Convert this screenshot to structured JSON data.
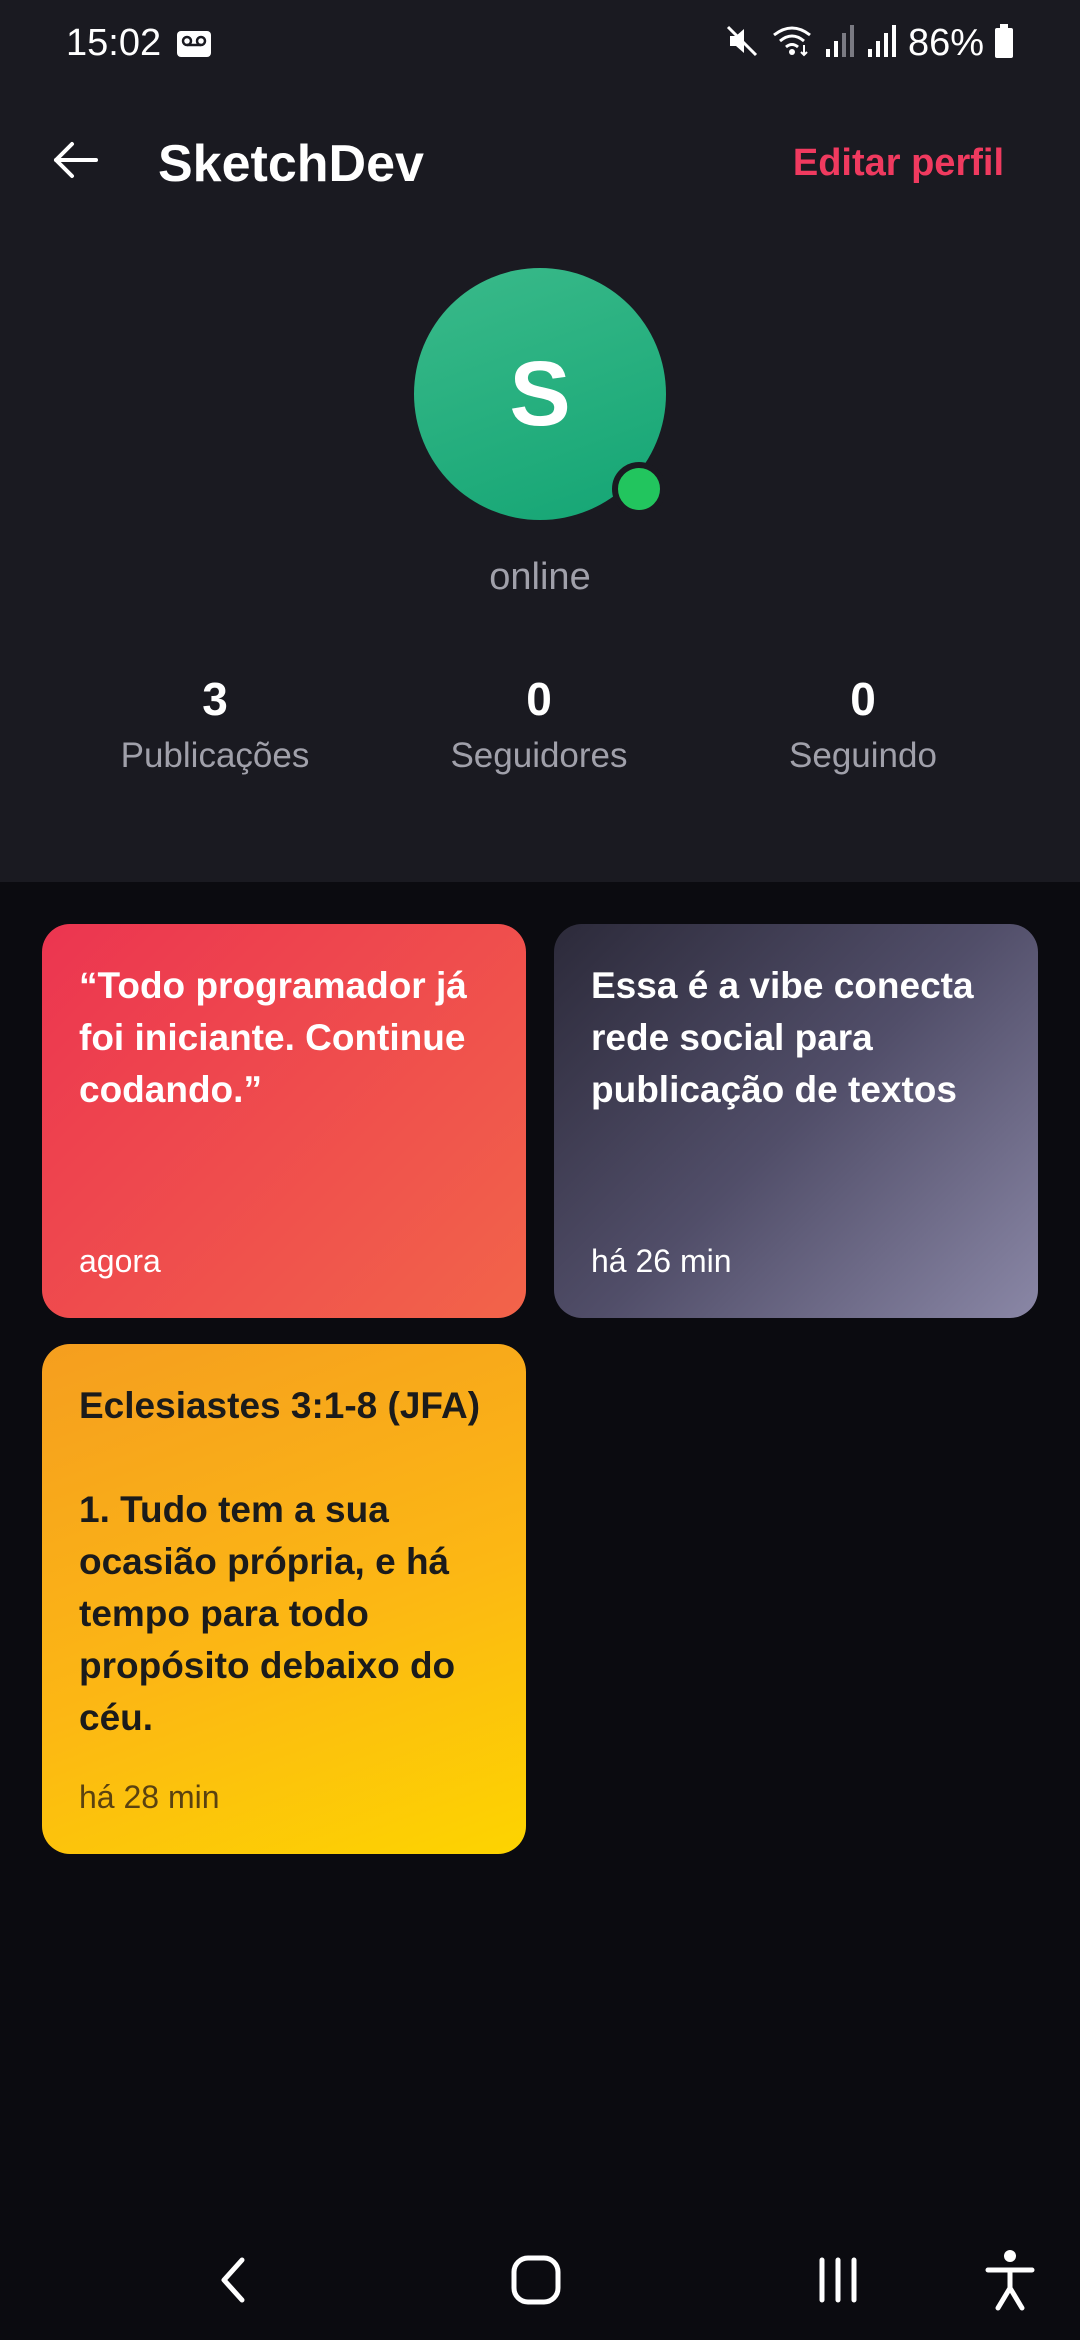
{
  "status_bar": {
    "time": "15:02",
    "battery": "86%",
    "icons": [
      "voicemail-icon",
      "mute-icon",
      "wifi-icon",
      "signal-icon",
      "signal-icon",
      "battery-icon"
    ]
  },
  "app_bar": {
    "title": "SketchDev",
    "edit_label": "Editar perfil",
    "accent_color": "#f03a5f"
  },
  "profile": {
    "avatar_letter": "S",
    "avatar_color": "#1fa97a",
    "status": "online",
    "status_color": "#22c55e"
  },
  "stats": [
    {
      "value": "3",
      "label": "Publicações"
    },
    {
      "value": "0",
      "label": "Seguidores"
    },
    {
      "value": "0",
      "label": "Seguindo"
    }
  ],
  "posts": [
    {
      "text": "“Todo programador já foi iniciante. Continue codando.”",
      "time": "agora",
      "color": "#ef4a4d"
    },
    {
      "text": "Essa é a vibe conecta rede social para publicação de textos",
      "time": "há 26 min",
      "color": "#5a5770"
    },
    {
      "text": "Eclesiastes 3:1-8 (JFA)\n\n1. Tudo tem a sua ocasião própria, e há tempo para todo propósito debaixo do céu.",
      "time": "há 28 min",
      "color": "#fcb714"
    }
  ],
  "nav": {
    "icons": [
      "back-nav-icon",
      "home-nav-icon",
      "recents-nav-icon",
      "accessibility-icon"
    ]
  }
}
